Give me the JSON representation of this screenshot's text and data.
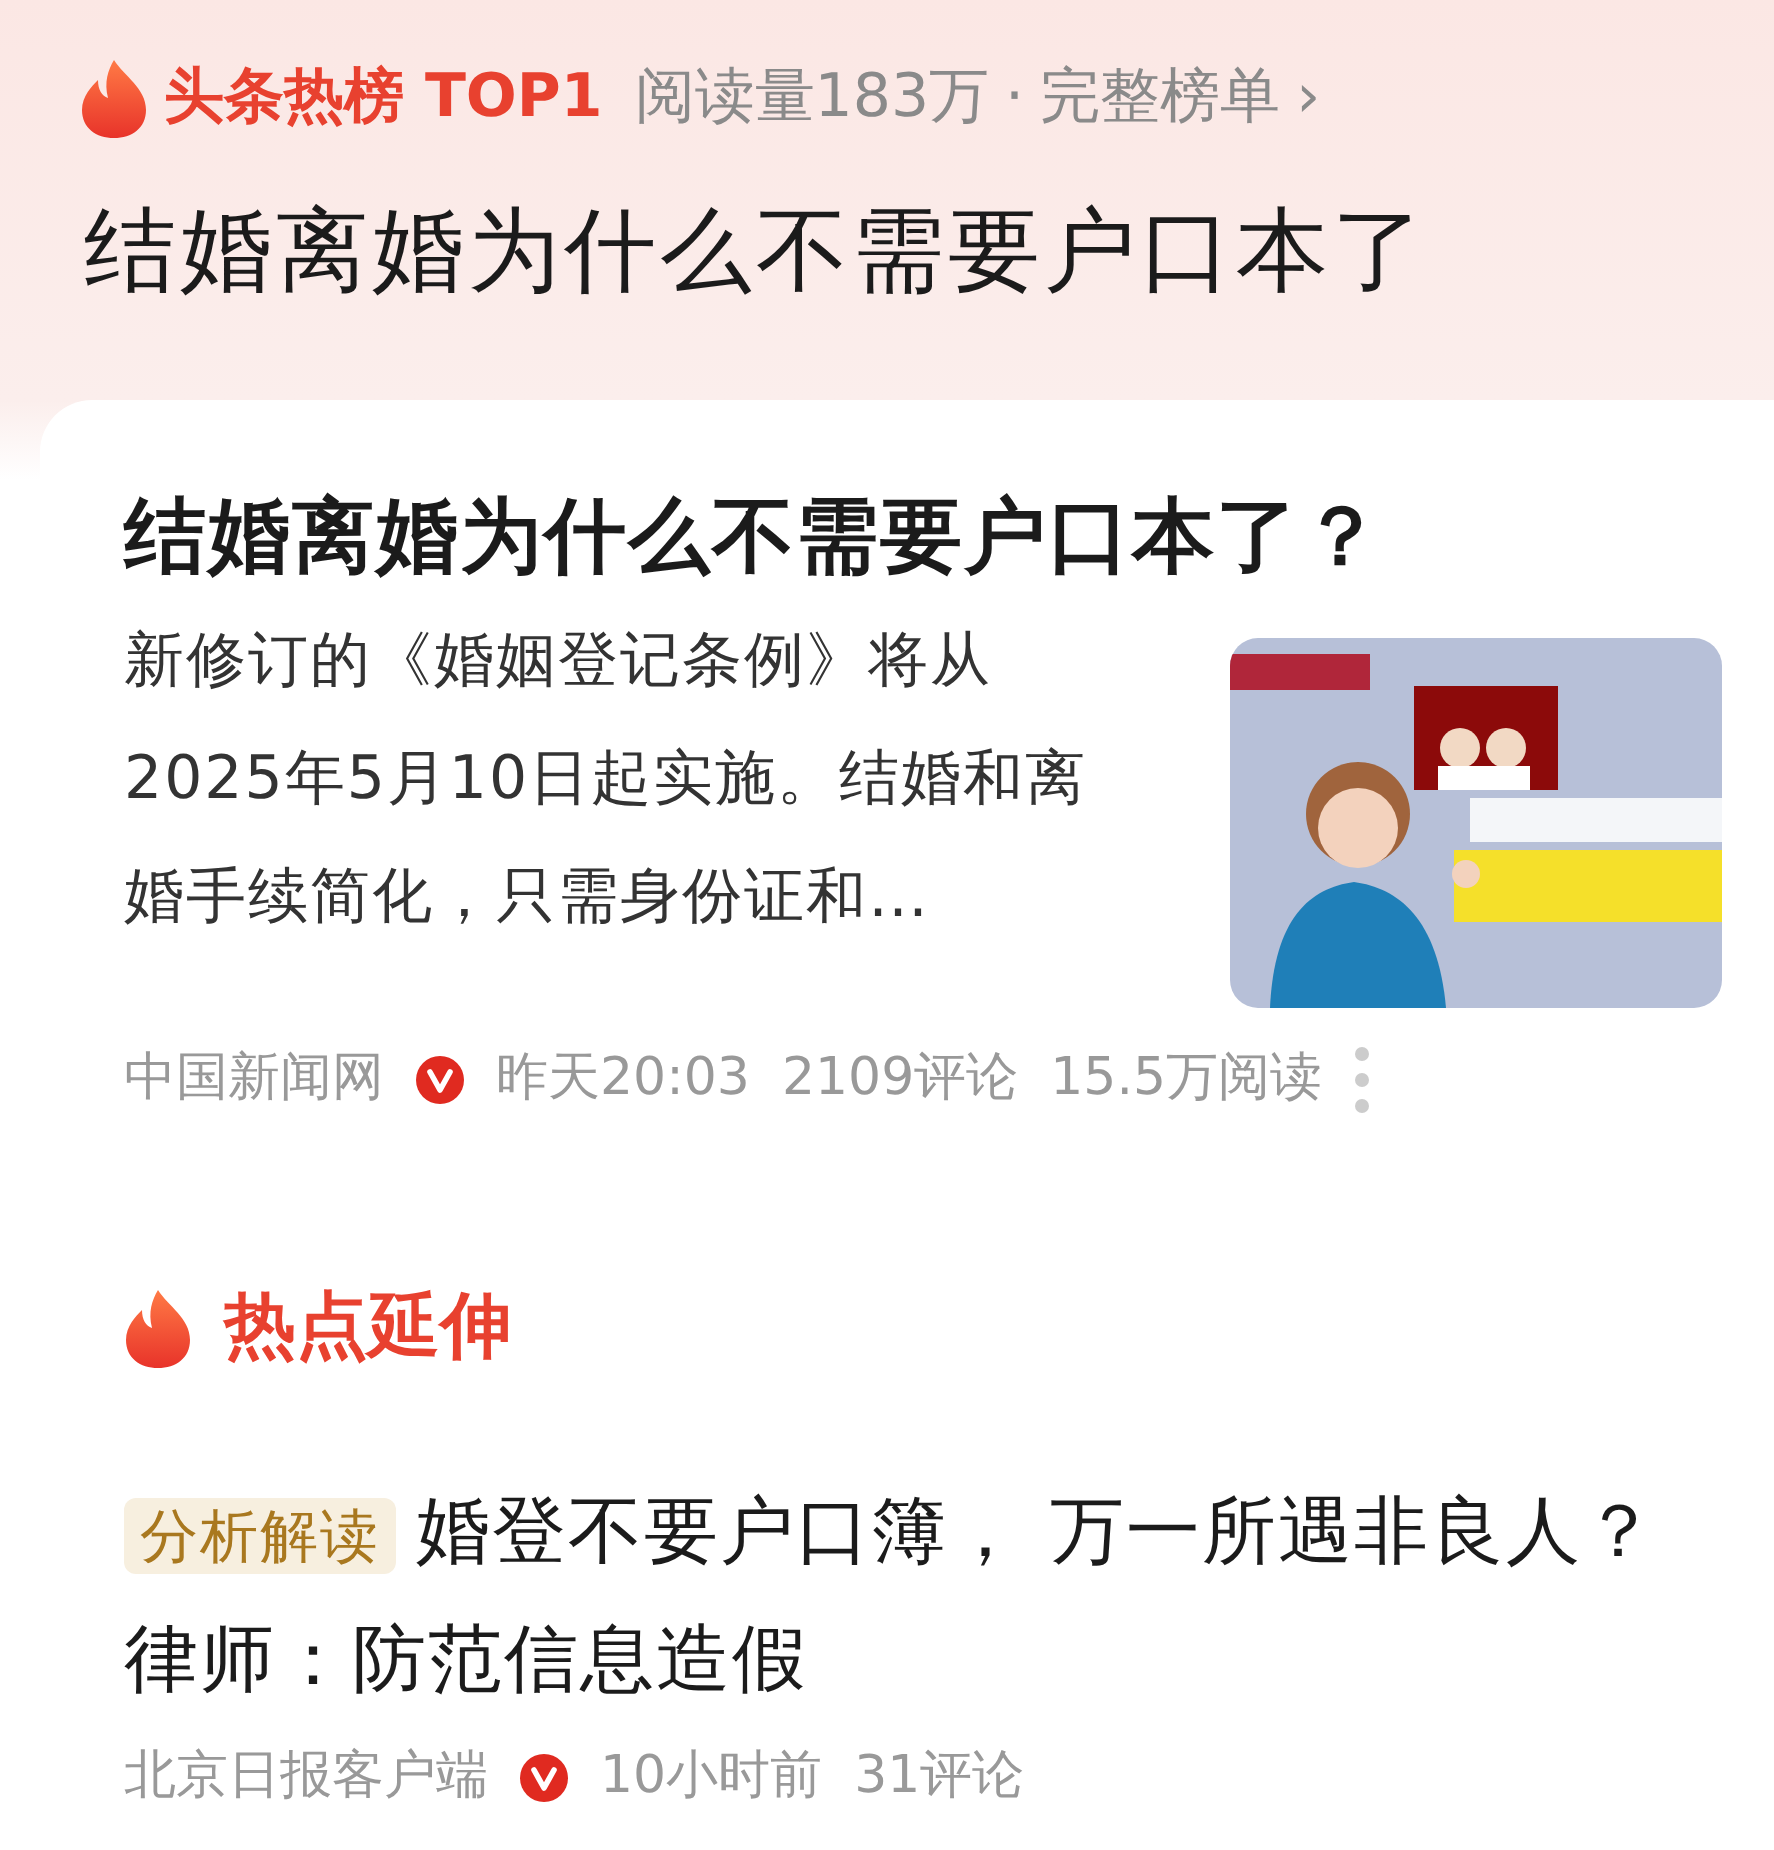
{
  "header": {
    "hot_label": "头条热榜 TOP1",
    "reads": "阅读量183万",
    "separator": "·",
    "full_list": "完整榜单",
    "chevron": "›"
  },
  "topic_title": "结婚离婚为什么不需要户口本了",
  "article": {
    "title": "结婚离婚为什么不需要户口本了？",
    "summary": "新修订的《婚姻登记条例》将从2025年5月10日起实施。结婚和离婚手续简化，只需身份证和…",
    "source": "中国新闻网",
    "verified": true,
    "time": "昨天20:03",
    "comments": "2109评论",
    "reads": "15.5万阅读"
  },
  "section": {
    "title": "热点延伸",
    "items": [
      {
        "tag": "分析解读",
        "title": "婚登不要户口簿， 万一所遇非良人？律师：防范信息造假",
        "source": "北京日报客户端",
        "verified": true,
        "time": "10小时前",
        "comments": "31评论"
      }
    ]
  }
}
